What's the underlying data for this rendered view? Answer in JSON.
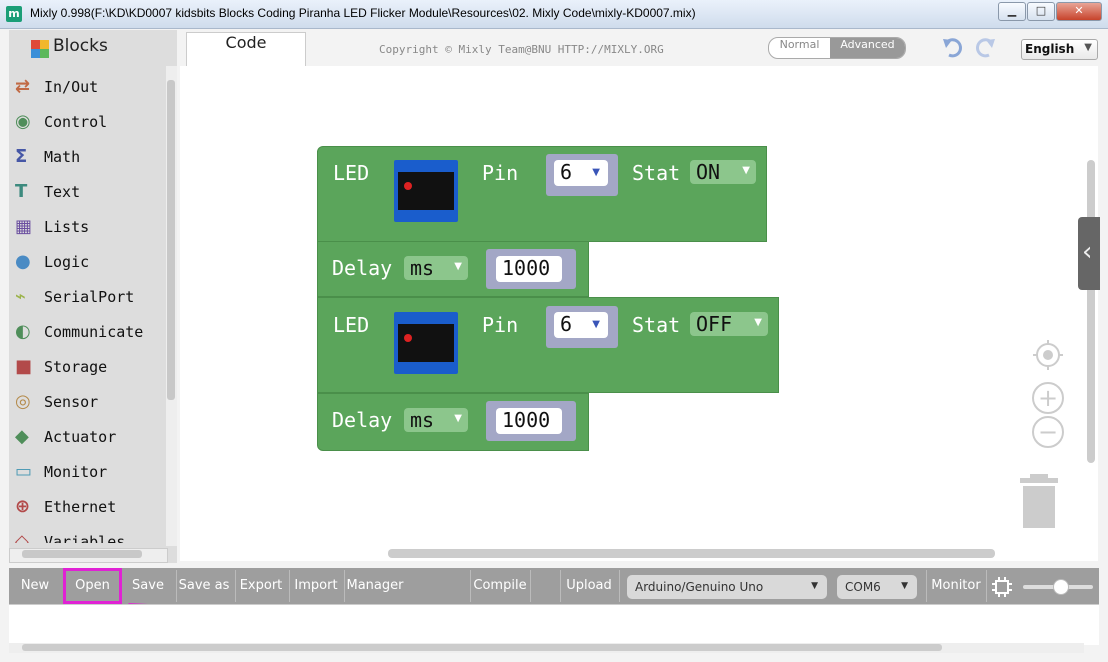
{
  "window": {
    "title": "Mixly 0.998(F:\\KD\\KD0007 kidsbits Blocks Coding Piranha LED Flicker  Module\\Resources\\02. Mixly Code\\mixly-KD0007.mix)",
    "app_icon": "m",
    "controls": {
      "minimize": "▁",
      "maximize": "□",
      "close": "✕"
    }
  },
  "sidebar": {
    "header": "Blocks",
    "categories": [
      {
        "label": "In/Out",
        "icon": "arrows-icon",
        "color": "#c16a45"
      },
      {
        "label": "Control",
        "icon": "gamepad-icon",
        "color": "#4f8e5a"
      },
      {
        "label": "Math",
        "icon": "sigma-icon",
        "color": "#4657a6"
      },
      {
        "label": "Text",
        "icon": "text-t-icon",
        "color": "#3d8a7e"
      },
      {
        "label": "Lists",
        "icon": "blocks-icon",
        "color": "#6b4fa0"
      },
      {
        "label": "Logic",
        "icon": "bulb-icon",
        "color": "#4a8bc4"
      },
      {
        "label": "SerialPort",
        "icon": "cable-icon",
        "color": "#9bb34a"
      },
      {
        "label": "Communicate",
        "icon": "satellite-icon",
        "color": "#4f8e5a"
      },
      {
        "label": "Storage",
        "icon": "floppy-icon",
        "color": "#b24a4a"
      },
      {
        "label": "Sensor",
        "icon": "sensor-icon",
        "color": "#b48a4a"
      },
      {
        "label": "Actuator",
        "icon": "actuator-icon",
        "color": "#4f8e5a"
      },
      {
        "label": "Monitor",
        "icon": "monitor-icon",
        "color": "#4f9bb5"
      },
      {
        "label": "Ethernet",
        "icon": "globe-icon",
        "color": "#b24a4a"
      },
      {
        "label": "Variables",
        "icon": "variables-icon",
        "color": "#b24a4a"
      }
    ]
  },
  "header": {
    "tab_code": "Code",
    "copyright": "Copyright © Mixly Team@BNU HTTP://MIXLY.ORG",
    "mode_normal": "Normal",
    "mode_advanced": "Advanced",
    "language": "English"
  },
  "workspace": {
    "blocks": [
      {
        "type": "led",
        "label": "LED",
        "pin_label": "Pin",
        "pin": "6",
        "stat_label": "Stat",
        "stat": "ON"
      },
      {
        "type": "delay",
        "label": "Delay",
        "unit": "ms",
        "value": "1000"
      },
      {
        "type": "led",
        "label": "LED",
        "pin_label": "Pin",
        "pin": "6",
        "stat_label": "Stat",
        "stat": "OFF"
      },
      {
        "type": "delay",
        "label": "Delay",
        "unit": "ms",
        "value": "1000"
      }
    ]
  },
  "toolbar": {
    "new": "New",
    "open": "Open",
    "save": "Save",
    "save_as": "Save as",
    "export": "Export",
    "import": "Import",
    "manager": "Manager",
    "compile": "Compile",
    "upload": "Upload",
    "board": "Arduino/Genuino Uno",
    "port": "COM6",
    "monitor": "Monitor"
  },
  "colors": {
    "block_green": "#5ba55b",
    "highlight": "#e022d4",
    "toolbar": "#9e9e9e"
  }
}
